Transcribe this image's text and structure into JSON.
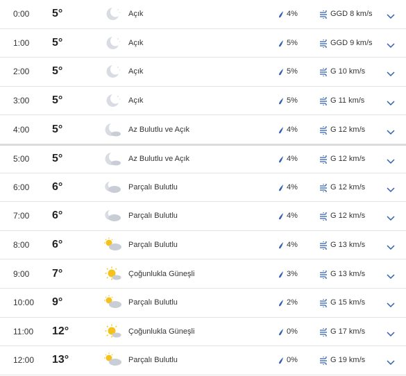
{
  "rows": [
    {
      "time": "0:00",
      "temp": "5°",
      "icon": "moon-clear-icon",
      "condition": "Açık",
      "precip": "4%",
      "wind": "GGD 8 km/s"
    },
    {
      "time": "1:00",
      "temp": "5°",
      "icon": "moon-clear-icon",
      "condition": "Açık",
      "precip": "5%",
      "wind": "GGD 9 km/s"
    },
    {
      "time": "2:00",
      "temp": "5°",
      "icon": "moon-clear-icon",
      "condition": "Açık",
      "precip": "5%",
      "wind": "G 10 km/s"
    },
    {
      "time": "3:00",
      "temp": "5°",
      "icon": "moon-clear-icon",
      "condition": "Açık",
      "precip": "5%",
      "wind": "G 11 km/s"
    },
    {
      "time": "4:00",
      "temp": "5°",
      "icon": "moon-cloud-icon",
      "condition": "Az Bulutlu ve Açık",
      "precip": "4%",
      "wind": "G 12 km/s"
    },
    {
      "time": "5:00",
      "temp": "5°",
      "icon": "moon-cloud-icon",
      "condition": "Az Bulutlu ve Açık",
      "precip": "4%",
      "wind": "G 12 km/s"
    },
    {
      "time": "6:00",
      "temp": "6°",
      "icon": "moon-cloudy-icon",
      "condition": "Parçalı Bulutlu",
      "precip": "4%",
      "wind": "G 12 km/s"
    },
    {
      "time": "7:00",
      "temp": "6°",
      "icon": "moon-cloudy-icon",
      "condition": "Parçalı Bulutlu",
      "precip": "4%",
      "wind": "G 12 km/s"
    },
    {
      "time": "8:00",
      "temp": "6°",
      "icon": "sun-cloud-icon",
      "condition": "Parçalı Bulutlu",
      "precip": "4%",
      "wind": "G 13 km/s"
    },
    {
      "time": "9:00",
      "temp": "7°",
      "icon": "sun-mostly-icon",
      "condition": "Çoğunlukla Güneşli",
      "precip": "3%",
      "wind": "G 13 km/s"
    },
    {
      "time": "10:00",
      "temp": "9°",
      "icon": "sun-cloud-icon",
      "condition": "Parçalı Bulutlu",
      "precip": "2%",
      "wind": "G 15 km/s"
    },
    {
      "time": "11:00",
      "temp": "12°",
      "icon": "sun-mostly-icon",
      "condition": "Çoğunlukla Güneşli",
      "precip": "0%",
      "wind": "G 17 km/s"
    },
    {
      "time": "12:00",
      "temp": "13°",
      "icon": "sun-cloud-icon",
      "condition": "Parçalı Bulutlu",
      "precip": "0%",
      "wind": "G 19 km/s"
    }
  ],
  "colors": {
    "accent": "#2f5fb3",
    "sun": "#f4c21a",
    "cloud": "#c9ced6",
    "moon": "#d9dde3"
  }
}
